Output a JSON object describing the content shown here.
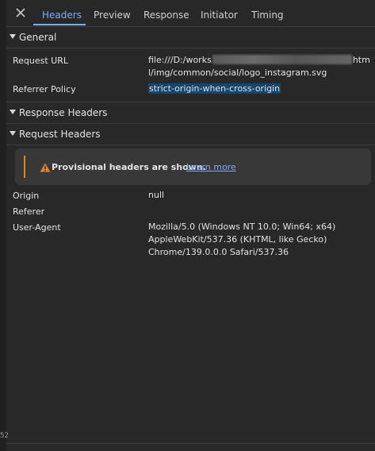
{
  "tabs": [
    {
      "label": "Headers",
      "active": true
    },
    {
      "label": "Preview",
      "active": false
    },
    {
      "label": "Response",
      "active": false
    },
    {
      "label": "Initiator",
      "active": false
    },
    {
      "label": "Timing",
      "active": false
    }
  ],
  "sections": {
    "general": "General",
    "response_headers": "Response Headers",
    "request_headers": "Request Headers"
  },
  "general": {
    "request_url_label": "Request URL",
    "request_url_line1_start": "file:///D:/works",
    "request_url_line1_end": "htm",
    "request_url_line2": "l/img/common/social/logo_instagram.svg",
    "referrer_policy_label": "Referrer Policy",
    "referrer_policy_value": "strict-origin-when-cross-origin"
  },
  "warning": {
    "text": "Provisional headers are shown.",
    "link": "Learn more"
  },
  "request_headers": {
    "origin_label": "Origin",
    "origin_value": "null",
    "referer_label": "Referer",
    "user_agent_label": "User-Agent",
    "user_agent_line1": "Mozilla/5.0 (Windows NT 10.0; Win64; x64)",
    "user_agent_line2": "AppleWebKit/537.36 (KHTML, like Gecko)",
    "user_agent_line3": "Chrome/139.0.0.0 Safari/537.36"
  },
  "left_strip_text": "52",
  "colors": {
    "background": "#282828",
    "accent": "#7cacf8",
    "warning": "#d38c2b",
    "selection": "#15466e"
  }
}
